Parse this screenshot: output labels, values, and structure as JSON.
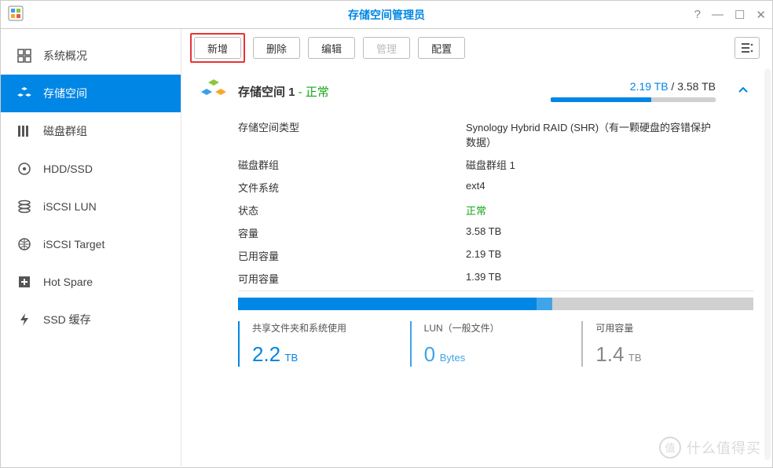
{
  "window": {
    "title": "存储空间管理员"
  },
  "sidebar": {
    "items": [
      {
        "label": "系统概况"
      },
      {
        "label": "存储空间"
      },
      {
        "label": "磁盘群组"
      },
      {
        "label": "HDD/SSD"
      },
      {
        "label": "iSCSI LUN"
      },
      {
        "label": "iSCSI Target"
      },
      {
        "label": "Hot Spare"
      },
      {
        "label": "SSD 缓存"
      }
    ]
  },
  "toolbar": {
    "create": "新增",
    "delete": "删除",
    "edit": "编辑",
    "manage": "管理",
    "config": "配置"
  },
  "volume": {
    "name": "存储空间 1",
    "status_suffix": " - 正常",
    "used_text": "2.19 TB",
    "total_text": " / 3.58 TB",
    "used_pct": 61,
    "rows": {
      "type_lbl": "存储空间类型",
      "type_val": "Synology Hybrid RAID (SHR)（有一颗硬盘的容错保护数据）",
      "group_lbl": "磁盘群组",
      "group_val": "磁盘群组 1",
      "fs_lbl": "文件系统",
      "fs_val": "ext4",
      "state_lbl": "状态",
      "state_val": "正常",
      "cap_lbl": "容量",
      "cap_val": "3.58 TB",
      "usedcap_lbl": "已用容量",
      "usedcap_val": "2.19 TB",
      "avail_lbl": "可用容量",
      "avail_val": "1.39 TB"
    },
    "bar": {
      "seg1_pct": 58,
      "seg2_pct": 3
    },
    "breakdown": {
      "s1_lbl": "共享文件夹和系统使用",
      "s1_num": "2.2",
      "s1_unit": " TB",
      "s2_lbl": "LUN（一般文件）",
      "s2_num": "0",
      "s2_unit": " Bytes",
      "s3_lbl": "可用容量",
      "s3_num": "1.4",
      "s3_unit": " TB"
    }
  },
  "watermark": "什么值得买"
}
